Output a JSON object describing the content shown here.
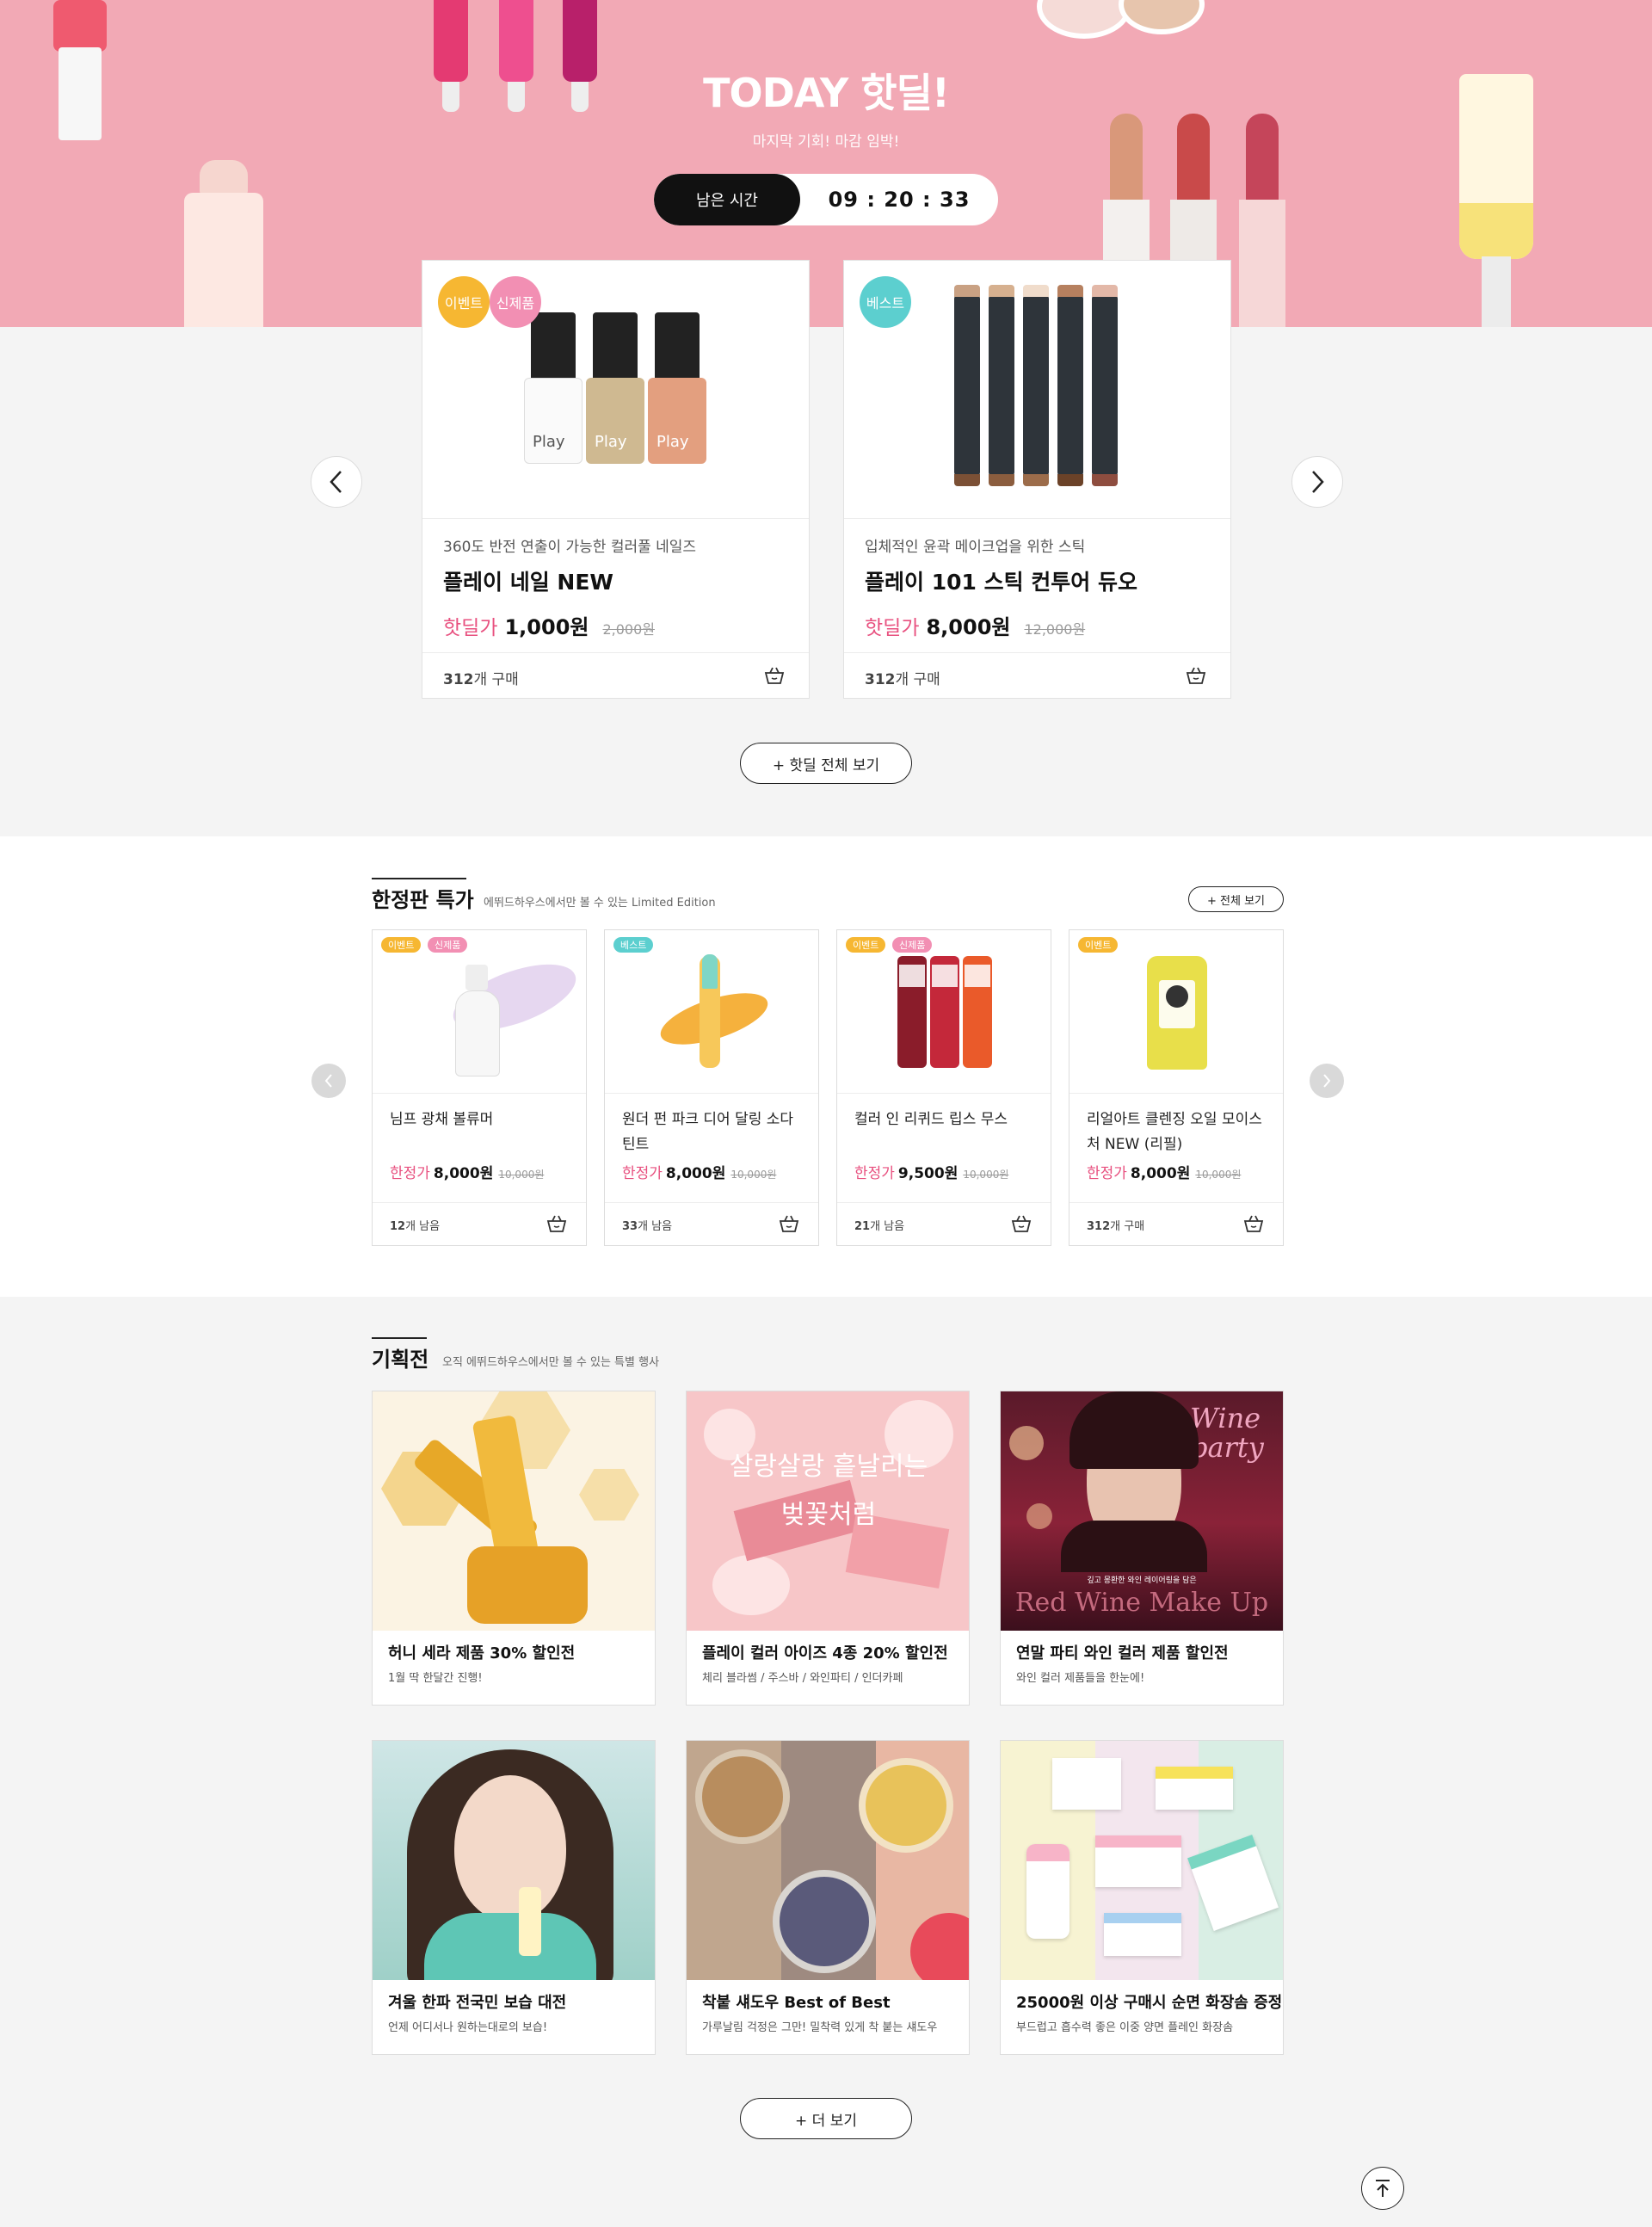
{
  "hero": {
    "title": "TODAY 핫딜!",
    "subtitle": "마지막 기회! 마감 임박!",
    "timer_label": "남은 시간",
    "timer_value": "09 : 20 : 33"
  },
  "hotdeal": {
    "items": [
      {
        "badges": [
          "이벤트",
          "신제품"
        ],
        "desc": "360도 반전 연출이 가능한 컬러풀 네일즈",
        "name": "플레이 네일 NEW",
        "price_label": "핫딜가",
        "price": "1,000원",
        "original_price": "2,000원",
        "count": "312",
        "count_unit": "개 구매"
      },
      {
        "badges": [
          "베스트"
        ],
        "desc": "입체적인 윤곽 메이크업을 위한 스틱",
        "name": "플레이 101 스틱 컨투어 듀오",
        "price_label": "핫딜가",
        "price": "8,000원",
        "original_price": "12,000원",
        "count": "312",
        "count_unit": "개 구매"
      }
    ],
    "view_all": "+ 핫딜 전체 보기",
    "nail_label": "Play"
  },
  "limited": {
    "title": "한정판 특가",
    "desc": "에뛰드하우스에서만 볼 수 있는 Limited Edition",
    "view_all": "+ 전체 보기",
    "items": [
      {
        "badges": [
          "이벤트",
          "신제품"
        ],
        "name": "님프 광채 볼류머",
        "price_label": "한정가",
        "price": "8,000원",
        "original_price": "10,000원",
        "count": "12",
        "count_unit": "개 남음"
      },
      {
        "badges": [
          "베스트"
        ],
        "name": "원더 펀 파크 디어 달링 소다 틴트",
        "price_label": "한정가",
        "price": "8,000원",
        "original_price": "10,000원",
        "count": "33",
        "count_unit": "개 남음"
      },
      {
        "badges": [
          "이벤트",
          "신제품"
        ],
        "name": "컬러 인 리퀴드 립스 무스",
        "price_label": "한정가",
        "price": "9,500원",
        "original_price": "10,000원",
        "count": "21",
        "count_unit": "개 남음"
      },
      {
        "badges": [
          "이벤트"
        ],
        "name": "리얼아트 클렌징 오일 모이스처 NEW (리필)",
        "price_label": "한정가",
        "price": "8,000원",
        "original_price": "10,000원",
        "count": "312",
        "count_unit": "개 구매"
      }
    ]
  },
  "events": {
    "title": "기획전",
    "desc": "오직 에뛰드하우스에서만 볼 수 있는 특별 행사",
    "items": [
      {
        "title": "허니 세라 제품 30% 할인전",
        "sub": "1월 딱 한달간 진행!"
      },
      {
        "title": "플레이 컬러 아이즈 4종 20% 할인전",
        "sub": "체리 블라썸 / 주스바 / 와인파티 / 인더카페",
        "img_text": "살랑살랑 흩날리는 벚꽃처럼"
      },
      {
        "title": "연말 파티 와인 컬러 제품 할인전",
        "sub": "와인 컬러 제품들을 한눈에!",
        "img_text": "Red Wine Make Up",
        "img_small": "깊고 몽환한 와인 레이어링을 담은",
        "img_script": "Wine party"
      },
      {
        "title": "겨울 한파 전국민 보습 대전",
        "sub": "언제 어디서나 원하는대로의 보습!"
      },
      {
        "title": "착붙 섀도우 Best of Best",
        "sub": "가루날림 걱정은 그만! 밀착력 있게 착 붙는 섀도우"
      },
      {
        "title": "25000원 이상 구매시 순면 화장솜 증정",
        "sub": "부드럽고 흡수력 좋은 이중 양면 플레인 화장솜"
      }
    ],
    "more": "+ 더 보기"
  },
  "colors": {
    "brand_pink": "#f2a9b5",
    "price_pink": "#e8507f",
    "badge_event": "#f6b732",
    "badge_new": "#f28fb3",
    "badge_best": "#5ccfcf"
  }
}
